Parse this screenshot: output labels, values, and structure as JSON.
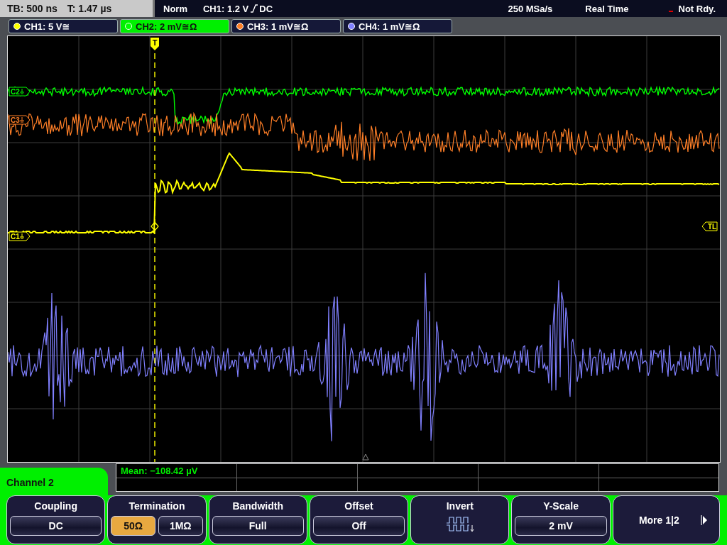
{
  "status_bar": {
    "timebase": "TB: 500 ns",
    "trigger_time": "T: 1.47 µs",
    "mode": "Norm",
    "trigger_source": "CH1: 1.2 V",
    "trigger_coupling": "DC",
    "sample_rate": "250 MSa/s",
    "acquisition": "Real Time",
    "state": "Not Rdy."
  },
  "channels": [
    {
      "label": "CH1: 5 V≅",
      "color": "#ffff00",
      "selected": false
    },
    {
      "label": "CH2: 2 mV≅Ω",
      "color": "#00ff00",
      "selected": true
    },
    {
      "label": "CH3: 1 mV≅Ω",
      "color": "#ff7f27",
      "selected": false
    },
    {
      "label": "CH4: 1 mV≅Ω",
      "color": "#8080ff",
      "selected": false
    }
  ],
  "display": {
    "trigger_label": "T",
    "trigger_level_label": "TL",
    "markers": [
      {
        "label": "C2",
        "color": "#00ff00"
      },
      {
        "label": "C3",
        "color": "#ff7f27"
      },
      {
        "label": "C1",
        "color": "#ffff00"
      }
    ]
  },
  "measurement": {
    "text": "Mean: −108.42 µV"
  },
  "menu": {
    "title": "Channel 2",
    "items": [
      {
        "kind": "single",
        "label": "Coupling",
        "value": "DC"
      },
      {
        "kind": "options",
        "label": "Termination",
        "options": [
          {
            "label": "50Ω",
            "selected": true
          },
          {
            "label": "1MΩ",
            "selected": false
          }
        ]
      },
      {
        "kind": "single",
        "label": "Bandwidth",
        "value": "Full"
      },
      {
        "kind": "single",
        "label": "Offset",
        "value": "Off"
      },
      {
        "kind": "icon",
        "label": "Invert"
      },
      {
        "kind": "single",
        "label": "Y-Scale",
        "value": "2 mV"
      },
      {
        "kind": "more",
        "label": "More 1|2"
      }
    ]
  }
}
